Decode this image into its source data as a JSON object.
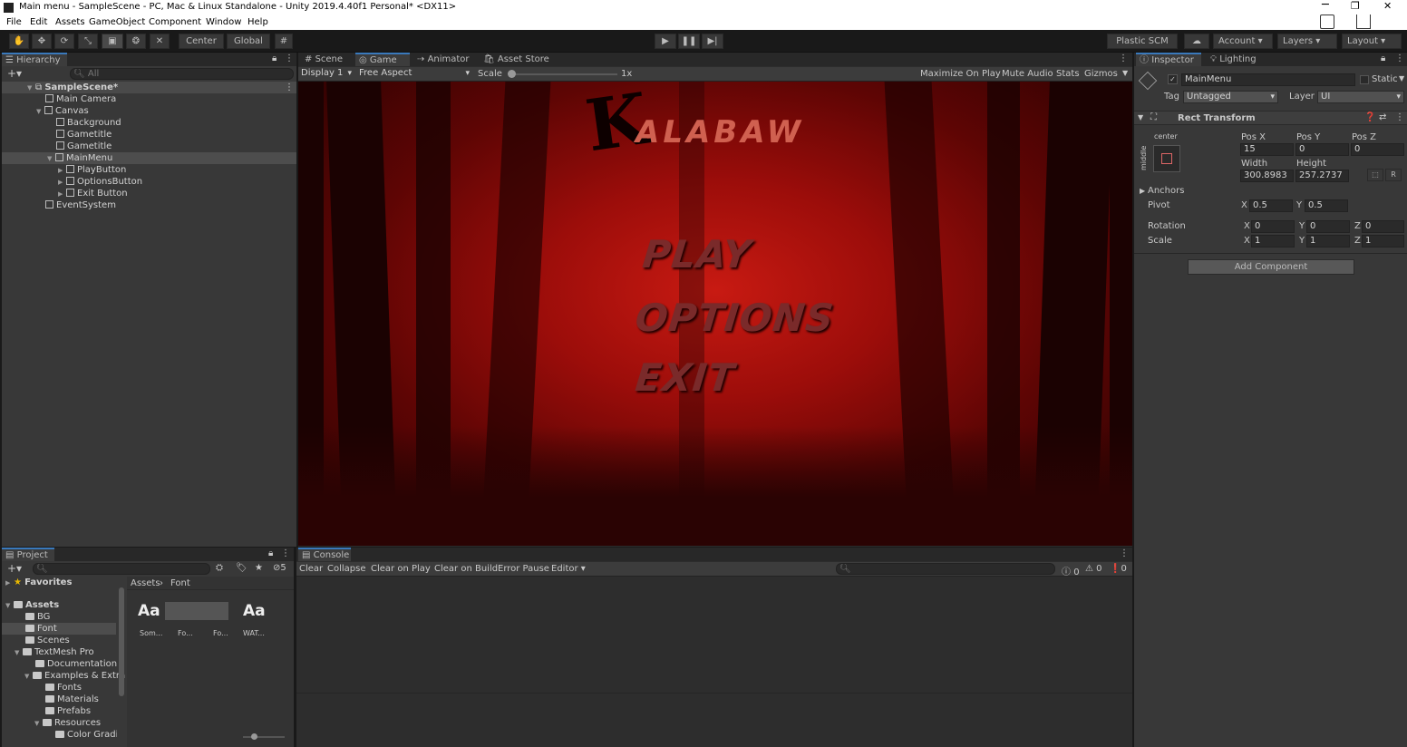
{
  "window": {
    "title": "Main menu - SampleScene - PC, Mac & Linux Standalone - Unity 2019.4.40f1 Personal* <DX11>",
    "controls": [
      "─",
      "❐",
      "✕"
    ]
  },
  "menubar": [
    "File",
    "Edit",
    "Assets",
    "GameObject",
    "Component",
    "Window",
    "Help"
  ],
  "toolbar": {
    "pivot": "Center",
    "space": "Global",
    "plastic": "Plastic SCM",
    "account": "Account",
    "layers": "Layers",
    "layout": "Layout"
  },
  "hierarchy": {
    "tab": "Hierarchy",
    "search_placeholder": "All",
    "items": [
      {
        "label": "SampleScene*",
        "depth": 0
      },
      {
        "label": "Main Camera",
        "depth": 1
      },
      {
        "label": "Canvas",
        "depth": 1
      },
      {
        "label": "Background",
        "depth": 2
      },
      {
        "label": "Gametitle",
        "depth": 2
      },
      {
        "label": "Gametitle",
        "depth": 2
      },
      {
        "label": "MainMenu",
        "depth": 2
      },
      {
        "label": "PlayButton",
        "depth": 3
      },
      {
        "label": "OptionsButton",
        "depth": 3
      },
      {
        "label": "Exit Button",
        "depth": 3
      },
      {
        "label": "EventSystem",
        "depth": 1
      }
    ]
  },
  "center_tabs": [
    "Scene",
    "Game",
    "Animator",
    "Asset Store"
  ],
  "game_toolbar": {
    "display": "Display 1",
    "aspect": "Free Aspect",
    "scale_label": "Scale",
    "scale_value": "1x",
    "maximize": "Maximize On Play",
    "mute": "Mute Audio",
    "stats": "Stats",
    "gizmos": "Gizmos"
  },
  "game": {
    "logo_initial": "K",
    "logo_rest": "ALABAW",
    "menu": [
      "PLAY",
      "OPTIONS",
      "EXIT"
    ]
  },
  "inspector": {
    "tabs": [
      "Inspector",
      "Lighting"
    ],
    "object_name": "MainMenu",
    "static_label": "Static",
    "tag_label": "Tag",
    "tag_value": "Untagged",
    "layer_label": "Layer",
    "layer_value": "UI",
    "component": "Rect Transform",
    "anchor_h": "center",
    "anchor_v": "middle",
    "posx_label": "Pos X",
    "posx": "15",
    "posy_label": "Pos Y",
    "posy": "0",
    "posz_label": "Pos Z",
    "posz": "0",
    "width_label": "Width",
    "width": "300.8983",
    "height_label": "Height",
    "height": "257.2737",
    "r_button": "R",
    "anchors": "Anchors",
    "pivot_label": "Pivot",
    "pivot_x": "0.5",
    "pivot_y": "0.5",
    "rotation_label": "Rotation",
    "rot_x": "0",
    "rot_y": "0",
    "rot_z": "0",
    "scale_label": "Scale",
    "scale_x": "1",
    "scale_y": "1",
    "scale_z": "1",
    "x": "X",
    "y": "Y",
    "z": "Z",
    "add_component": "Add Component"
  },
  "project": {
    "tab": "Project",
    "favorites": "Favorites",
    "tree": [
      {
        "label": "Assets",
        "depth": 0
      },
      {
        "label": "BG",
        "depth": 1
      },
      {
        "label": "Font",
        "depth": 1
      },
      {
        "label": "Scenes",
        "depth": 1
      },
      {
        "label": "TextMesh Pro",
        "depth": 1
      },
      {
        "label": "Documentation",
        "depth": 2
      },
      {
        "label": "Examples & Extra",
        "depth": 2
      },
      {
        "label": "Fonts",
        "depth": 3
      },
      {
        "label": "Materials",
        "depth": 3
      },
      {
        "label": "Prefabs",
        "depth": 3
      },
      {
        "label": "Resources",
        "depth": 3
      },
      {
        "label": "Color Gradie",
        "depth": 4
      }
    ],
    "breadcrumb": [
      "Assets",
      "Font"
    ],
    "hidden_count": "5",
    "assets": [
      {
        "icon": "Aa",
        "name": "Som..."
      },
      {
        "icon": "",
        "name": "Fo..."
      },
      {
        "icon": "",
        "name": "Fo..."
      },
      {
        "icon": "Aa",
        "name": "WAT..."
      }
    ]
  },
  "console": {
    "tab": "Console",
    "buttons": [
      "Clear",
      "Collapse",
      "Clear on Play",
      "Clear on Build",
      "Error Pause",
      "Editor"
    ],
    "counts": [
      "0",
      "0",
      "0"
    ]
  }
}
